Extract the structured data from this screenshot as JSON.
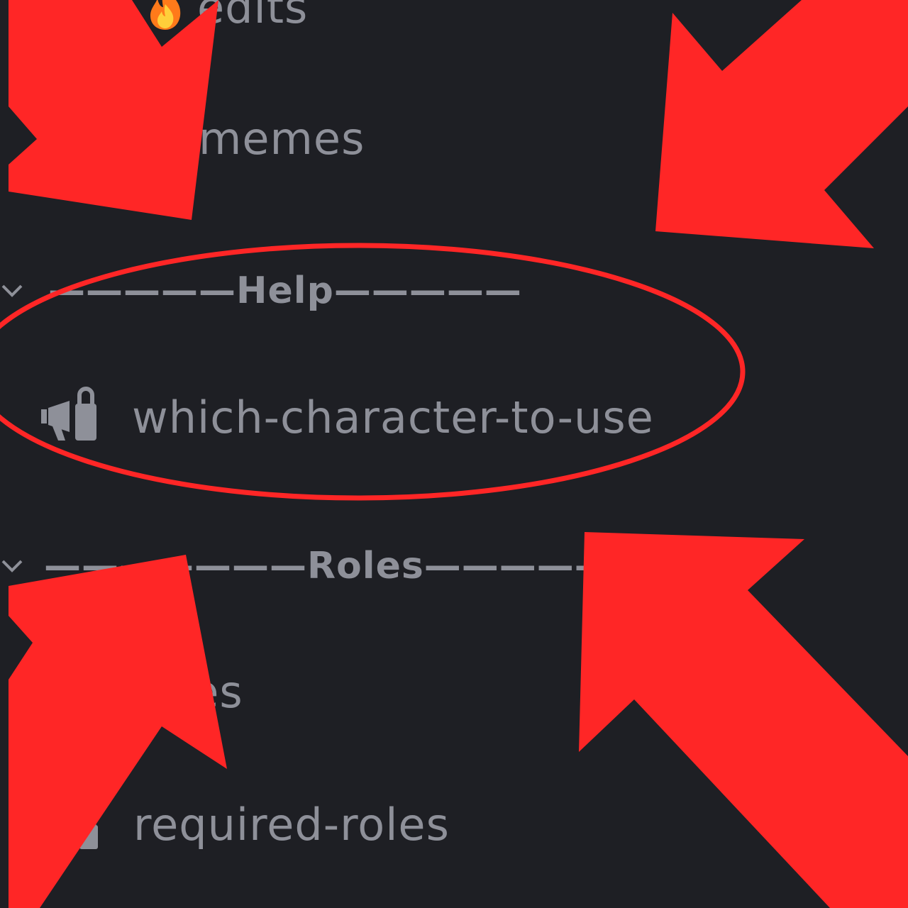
{
  "sidebar": {
    "channels_top": [
      {
        "icon": "fire-emoji-icon",
        "label": "edits"
      },
      {
        "icon": "hash-icon",
        "label": "memes"
      }
    ],
    "categories": [
      {
        "chevron": "chevron-down-icon",
        "label": "—————Help—————",
        "channels": [
          {
            "icon": "megaphone-lock-icon",
            "label": "which-character-to-use"
          }
        ]
      },
      {
        "chevron": "chevron-down-icon",
        "label": "———————Roles—————————",
        "channels": [
          {
            "icon": "hash-icon",
            "label": "roles"
          },
          {
            "icon": "hash-lock-icon",
            "label": "required-roles"
          }
        ]
      }
    ]
  },
  "annotations": {
    "arrow_color": "#ff2626",
    "highlight_ring_color": "#ff2626",
    "highlighted_channel": "which-character-to-use"
  },
  "colors": {
    "background": "#1e1f24",
    "text_muted": "#8e9099"
  }
}
